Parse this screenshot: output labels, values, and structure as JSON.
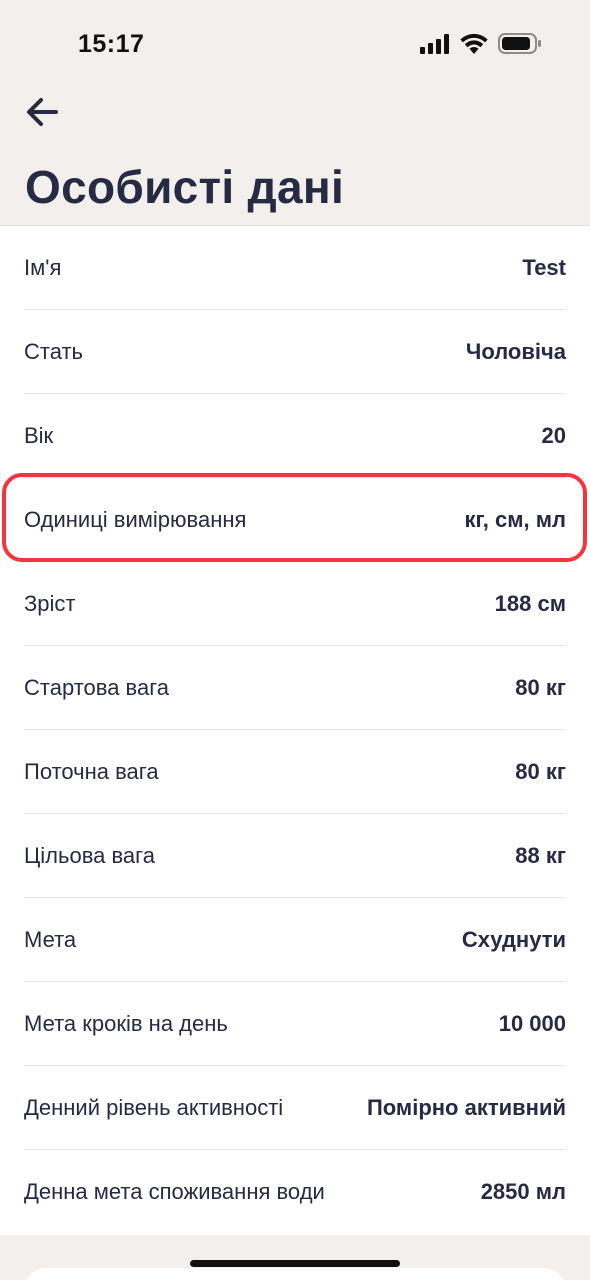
{
  "status_bar": {
    "time": "15:17",
    "icons": [
      "cellular-signal-icon",
      "wifi-icon",
      "battery-icon"
    ]
  },
  "header": {
    "back_icon": "arrow-left-icon",
    "title": "Особисті дані"
  },
  "rows": [
    {
      "label": "Ім'я",
      "value": "Test"
    },
    {
      "label": "Стать",
      "value": "Чоловіча"
    },
    {
      "label": "Вік",
      "value": "20"
    },
    {
      "label": "Одиниці вимірювання",
      "value": "кг, см, мл"
    },
    {
      "label": "Зріст",
      "value": "188 см"
    },
    {
      "label": "Стартова вага",
      "value": "80 кг"
    },
    {
      "label": "Поточна вага",
      "value": "80 кг"
    },
    {
      "label": "Цільова вага",
      "value": "88 кг"
    },
    {
      "label": "Мета",
      "value": "Схуднути"
    },
    {
      "label": "Мета кроків на день",
      "value": "10 000"
    },
    {
      "label": "Денний рівень активності",
      "value": "Помірно активний"
    },
    {
      "label": "Денна мета споживання води",
      "value": "2850 мл"
    }
  ],
  "colors": {
    "background": "#f2efec",
    "text": "#252b42",
    "highlight": "#f2353f"
  }
}
